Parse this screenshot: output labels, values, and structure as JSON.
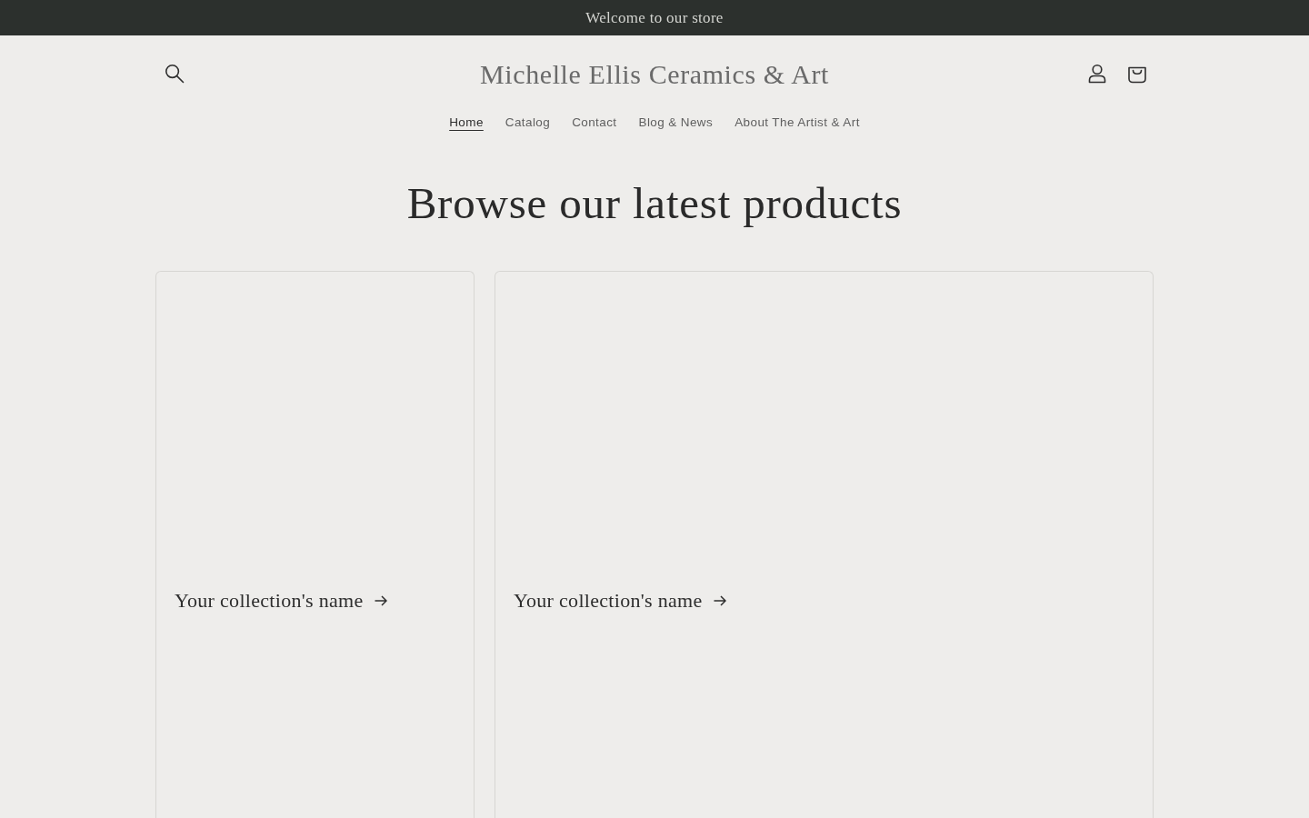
{
  "announcement": {
    "text": "Welcome to our store"
  },
  "header": {
    "logo": "Michelle Ellis Ceramics & Art"
  },
  "nav": [
    {
      "label": "Home",
      "selected": true
    },
    {
      "label": "Catalog",
      "selected": false
    },
    {
      "label": "Contact",
      "selected": false
    },
    {
      "label": "Blog & News",
      "selected": false
    },
    {
      "label": "About The Artist & Art",
      "selected": false
    }
  ],
  "heading": "Browse our latest products",
  "collections": [
    {
      "name": "Your collection's name"
    },
    {
      "name": "Your collection's name"
    }
  ]
}
